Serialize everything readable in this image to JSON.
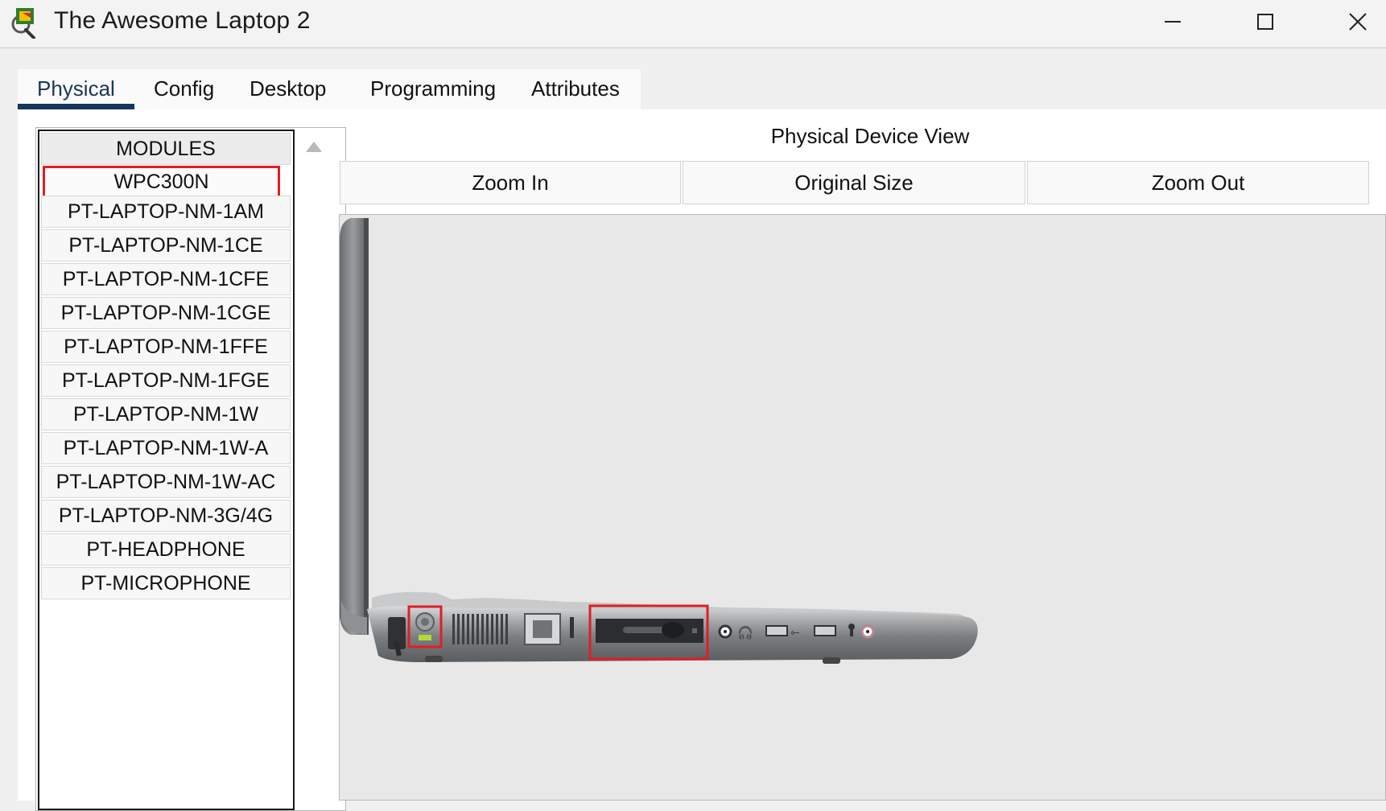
{
  "window": {
    "title": "The Awesome Laptop 2",
    "icons": [
      "app-icon",
      "minimize-icon",
      "maximize-icon",
      "close-icon"
    ]
  },
  "tabs": [
    {
      "label": "Physical",
      "active": true
    },
    {
      "label": "Config"
    },
    {
      "label": "Desktop"
    },
    {
      "label": "Programming"
    },
    {
      "label": "Attributes"
    }
  ],
  "modules": {
    "header": "MODULES",
    "items": [
      "WPC300N",
      "PT-LAPTOP-NM-1AM",
      "PT-LAPTOP-NM-1CE",
      "PT-LAPTOP-NM-1CFE",
      "PT-LAPTOP-NM-1CGE",
      "PT-LAPTOP-NM-1FFE",
      "PT-LAPTOP-NM-1FGE",
      "PT-LAPTOP-NM-1W",
      "PT-LAPTOP-NM-1W-A",
      "PT-LAPTOP-NM-1W-AC",
      "PT-LAPTOP-NM-3G/4G",
      "PT-HEADPHONE",
      "PT-MICROPHONE"
    ],
    "highlighted": "WPC300N"
  },
  "device_view": {
    "title": "Physical Device View",
    "zoom_in": "Zoom In",
    "original_size": "Original Size",
    "zoom_out": "Zoom Out"
  },
  "colors": {
    "highlight": "#e01e25",
    "active_tab": "#17365c"
  }
}
